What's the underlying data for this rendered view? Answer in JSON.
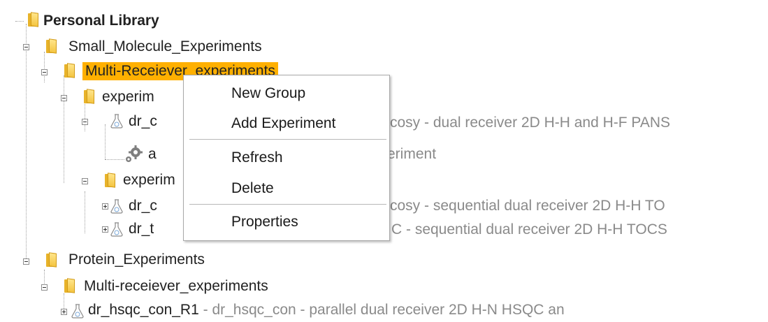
{
  "tree": {
    "root": {
      "label": "Personal Library"
    },
    "small_molecule": {
      "label": "Small_Molecule_Experiments"
    },
    "multi_receiver": {
      "label": "Multi-Receiever_experiments",
      "selected": true
    },
    "exp1": {
      "label": "experim"
    },
    "dr_c1": {
      "label": "dr_c",
      "desc": "cosy - dual receiver 2D H-H and H-F PANS"
    },
    "gear_item": {
      "label": "a",
      "desc": "eriment"
    },
    "exp2": {
      "label": "experim"
    },
    "dr_c2": {
      "label": "dr_c",
      "desc": "cosy - sequential dual receiver 2D H-H TO"
    },
    "dr_t": {
      "label": "dr_t",
      "desc": "C - sequential dual receiver 2D H-H TOCS"
    },
    "protein": {
      "label": "Protein_Experiments"
    },
    "multi_receiver2": {
      "label": "Multi-receiever_experiments"
    },
    "dr_hsqc": {
      "label": "dr_hsqc_con_R1",
      "desc": " - dr_hsqc_con - parallel dual receiver 2D H-N HSQC an"
    }
  },
  "context_menu": {
    "items": [
      "New Group",
      "Add Experiment",
      "Refresh",
      "Delete",
      "Properties"
    ]
  },
  "colors": {
    "selection": "#ffb000",
    "folder": "#f4c542",
    "description_text": "#8a8a8a"
  },
  "icons": {
    "folder": "folder-icon",
    "experiment": "flask-icon",
    "process": "gear-icon",
    "expand": "plus-toggle-icon",
    "collapse": "minus-toggle-icon"
  }
}
